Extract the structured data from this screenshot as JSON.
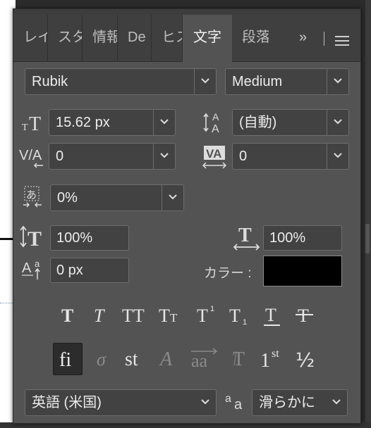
{
  "tabs": [
    {
      "label": "レイ"
    },
    {
      "label": "スタ"
    },
    {
      "label": "情報"
    },
    {
      "label": "De"
    },
    {
      "label": "ヒス"
    },
    {
      "label": "文字",
      "active": true
    },
    {
      "label": "段落"
    }
  ],
  "tab_more": "»",
  "font": {
    "family": "Rubik",
    "style": "Medium"
  },
  "size": {
    "value": "15.62 px"
  },
  "leading": {
    "value": "(自動)"
  },
  "kerning": {
    "value": "0"
  },
  "tracking": {
    "value": "0"
  },
  "tsume": {
    "value": "0%"
  },
  "vertical_scale": {
    "value": "100%"
  },
  "horizontal_scale": {
    "value": "100%"
  },
  "baseline": {
    "value": "0 px"
  },
  "color": {
    "label": "カラー :",
    "swatch": "#000000"
  },
  "style_buttons": [
    "faux-bold",
    "faux-italic",
    "all-caps",
    "small-caps",
    "superscript",
    "subscript",
    "underline",
    "strikethrough"
  ],
  "opentype_buttons": {
    "ligatures": "fi",
    "discretionary": "st",
    "ordinals": "st",
    "ordinals_base": "1",
    "fractions": "½",
    "titling": "T",
    "contextual": "aa",
    "swash": "A",
    "old_style": "o",
    "active": "ligatures"
  },
  "language": {
    "value": "英語 (米国)"
  },
  "antialias": {
    "value": "滑らかに"
  },
  "colors": {
    "panel": "#535353",
    "field": "#424242",
    "tabbar": "#3f3f3f"
  }
}
